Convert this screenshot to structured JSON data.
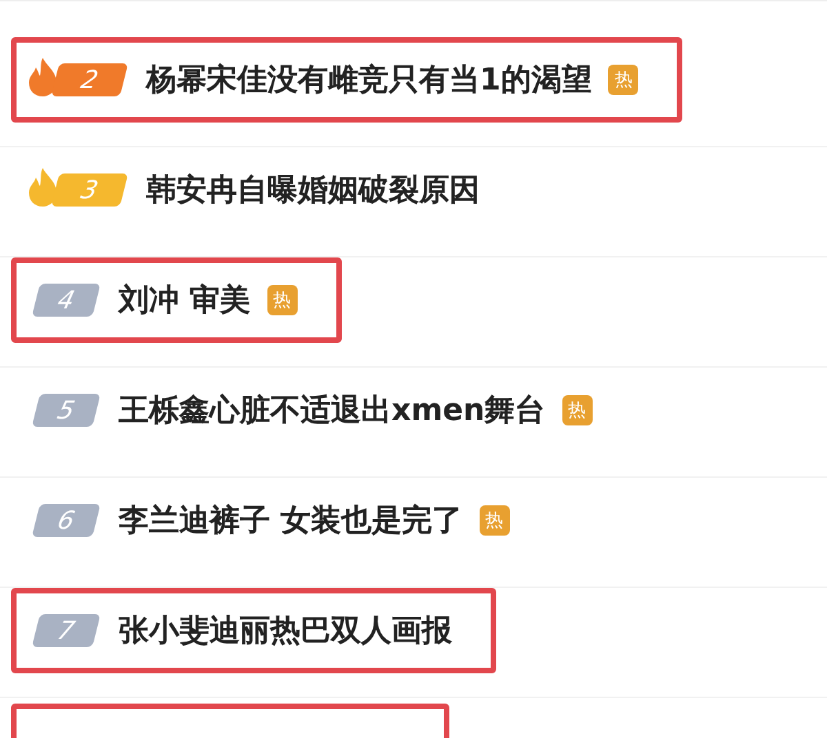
{
  "items": [
    {
      "rank": "2",
      "title": "杨幂宋佳没有雌竞只有当1的渴望",
      "hot_tag": "热",
      "highlighted": true,
      "kind": "flame",
      "color": "#f07a2a"
    },
    {
      "rank": "3",
      "title": "韩安冉自曝婚姻破裂原因",
      "highlighted": false,
      "kind": "flame",
      "color": "#f5b82e"
    },
    {
      "rank": "4",
      "title": "刘冲 审美",
      "hot_tag": "热",
      "highlighted": true,
      "kind": "plain",
      "color": "#a9b2c3"
    },
    {
      "rank": "5",
      "title": "王栎鑫心脏不适退出xmen舞台",
      "hot_tag": "热",
      "highlighted": false,
      "kind": "plain",
      "color": "#a9b2c3"
    },
    {
      "rank": "6",
      "title": "李兰迪裤子 女装也是完了",
      "hot_tag": "热",
      "highlighted": false,
      "kind": "plain",
      "color": "#a9b2c3"
    },
    {
      "rank": "7",
      "title": "张小斐迪丽热巴双人画报",
      "highlighted": true,
      "kind": "plain",
      "color": "#a9b2c3"
    }
  ],
  "cut_row": {
    "highlighted": true
  }
}
